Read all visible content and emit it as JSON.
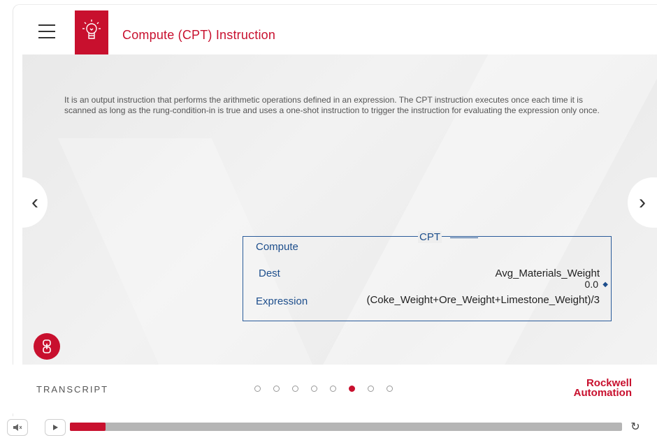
{
  "header": {
    "title": "Compute (CPT) Instruction",
    "menu_icon": "hamburger-icon",
    "logo_icon": "lightbulb-icon"
  },
  "main": {
    "intro_text": "It is an output instruction that performs the arithmetic operations defined in an expression. The CPT instruction executes once each time it is scanned as long as the rung-condition-in is true and uses a one-shot instruction to trigger the instruction for evaluating the expression only once.",
    "prev_icon": "chevron-left-icon",
    "next_icon": "chevron-right-icon",
    "prev_glyph": "‹",
    "next_glyph": "›"
  },
  "cpt_block": {
    "header": "CPT",
    "compute_label": "Compute",
    "dest_label": "Dest",
    "dest_value": "Avg_Materials_Weight",
    "dest_number": "0.0",
    "expression_label": "Expression",
    "expression_value": "(Coke_Weight+Ore_Weight+Limestone_Weight)/3"
  },
  "footer": {
    "transcript_label": "TRANSCRIPT",
    "slide_count": 8,
    "active_slide": 6,
    "brand_line1": "Rockwell",
    "brand_line2": "Automation"
  },
  "player": {
    "progress": 0.065,
    "volume_icon": "volume-icon",
    "play_icon": "play-icon",
    "replay_icon": "replay-icon",
    "replay_glyph": "↻"
  },
  "colors": {
    "accent": "#c8102e",
    "cpt_blue": "#1d4e8c"
  }
}
